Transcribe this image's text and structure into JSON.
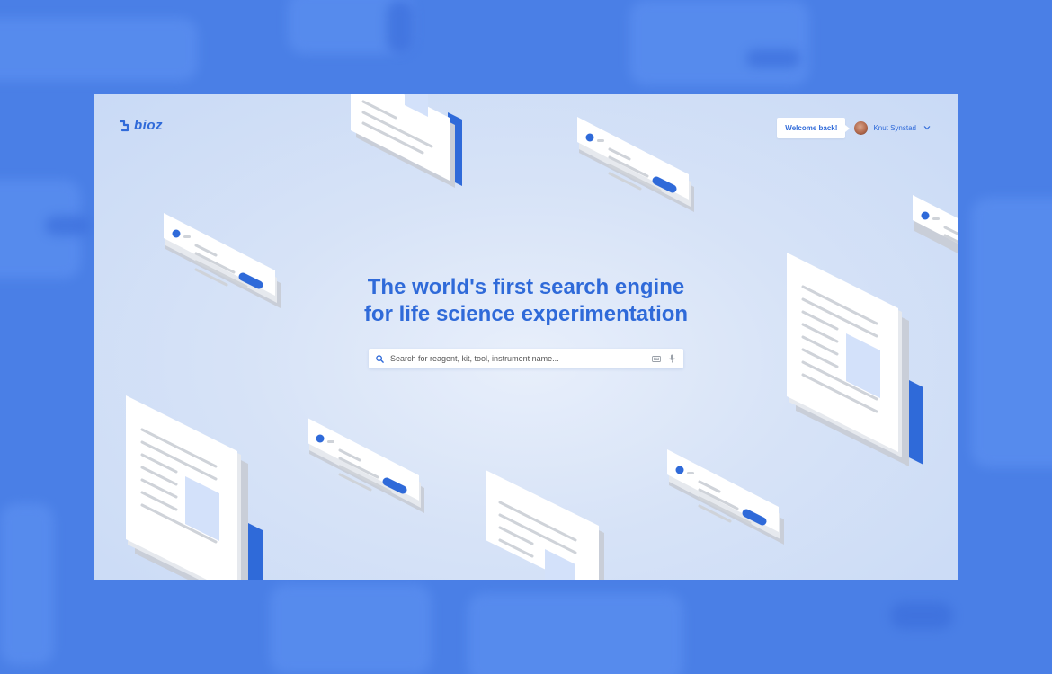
{
  "header": {
    "logo_text": "bioz",
    "welcome_label": "Welcome back!",
    "user_name": "Knut Synstad"
  },
  "hero": {
    "headline_line1": "The world's first search engine",
    "headline_line2": "for life science experimentation"
  },
  "search": {
    "placeholder": "Search for reagent, kit, tool, instrument name..."
  },
  "icons": {
    "search": "search-icon",
    "keyboard": "keyboard-icon",
    "microphone": "microphone-icon",
    "chevron": "chevron-down-icon"
  },
  "colors": {
    "accent": "#2f6ad9",
    "page_background": "#4a7fe6"
  }
}
